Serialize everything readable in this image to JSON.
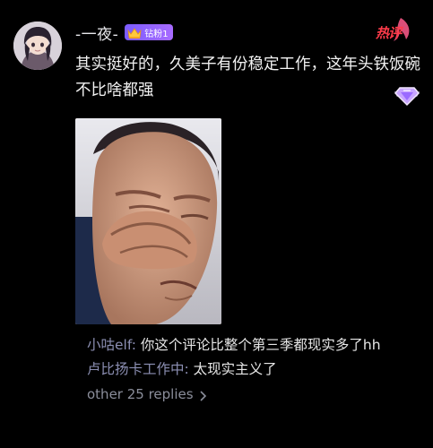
{
  "comment": {
    "username": "-一夜-",
    "fan_badge": {
      "label": "钻粉1",
      "icon": "crown-icon",
      "color": "#8b5cff"
    },
    "hot_label": "热评",
    "text": "其实挺好的，久美子有份稳定工作，这年头铁饭碗不比啥都强",
    "image": {
      "description_icon": "photo"
    }
  },
  "replies": [
    {
      "author": "小咕elf: ",
      "text": "你这个评论比整个第三季都现实多了hh"
    },
    {
      "author": "卢比扬卡工作中: ",
      "text": "太现实主义了"
    }
  ],
  "more_replies": "other 25 replies",
  "colors": {
    "background": "#000000",
    "reply_author": "#8c8fb3",
    "hot": "#ff3b4a"
  }
}
